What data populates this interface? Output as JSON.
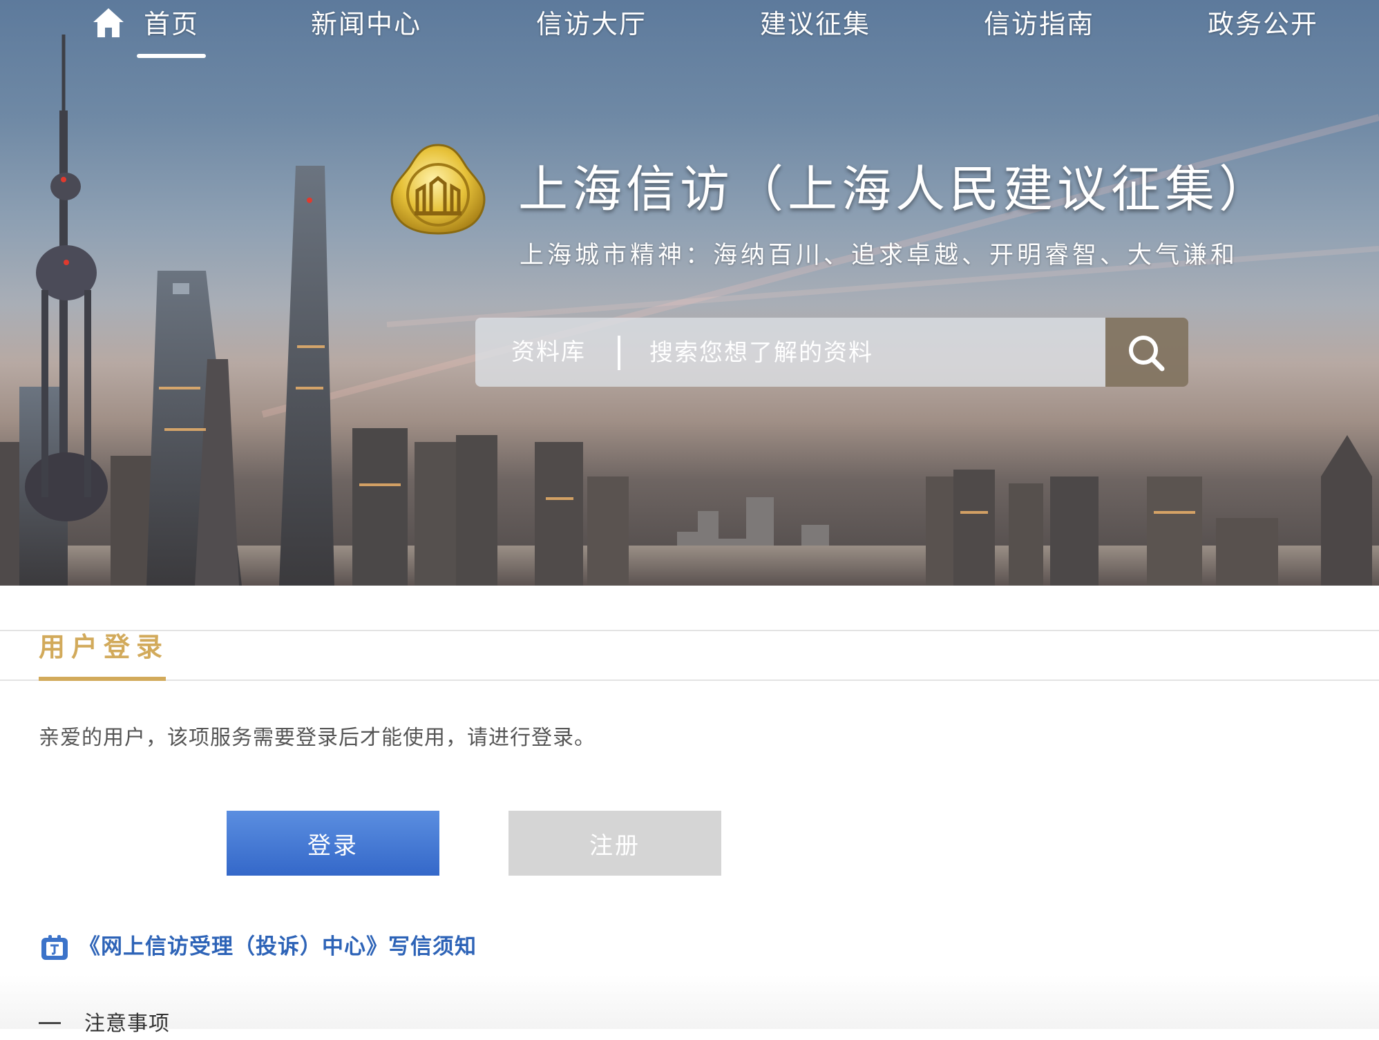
{
  "nav": {
    "items": [
      {
        "label": "首页",
        "active": true
      },
      {
        "label": "新闻中心"
      },
      {
        "label": "信访大厅"
      },
      {
        "label": "建议征集"
      },
      {
        "label": "信访指南"
      },
      {
        "label": "政务公开"
      }
    ],
    "home_icon": "home-icon"
  },
  "brand": {
    "title": "上海信访（上海人民建议征集）",
    "subtitle": "上海城市精神：海纳百川、追求卓越、开明睿智、大气谦和"
  },
  "search": {
    "category": "资料库",
    "placeholder": "搜索您想了解的资料",
    "icon": "search-icon"
  },
  "login": {
    "title": "用户登录",
    "message": "亲爱的用户，该项服务需要登录后才能使用，请进行登录。",
    "login_label": "登录",
    "register_label": "注册"
  },
  "notice": {
    "link_text": "《网上信访受理（投诉）中心》写信须知",
    "icon": "document-icon"
  },
  "notes": {
    "heading": "注意事项"
  },
  "colors": {
    "gold_accent": "#d2aa5b",
    "login_blue": "#3b70cf",
    "link_blue": "#2d63b7",
    "register_gray": "#d5d5d5"
  }
}
